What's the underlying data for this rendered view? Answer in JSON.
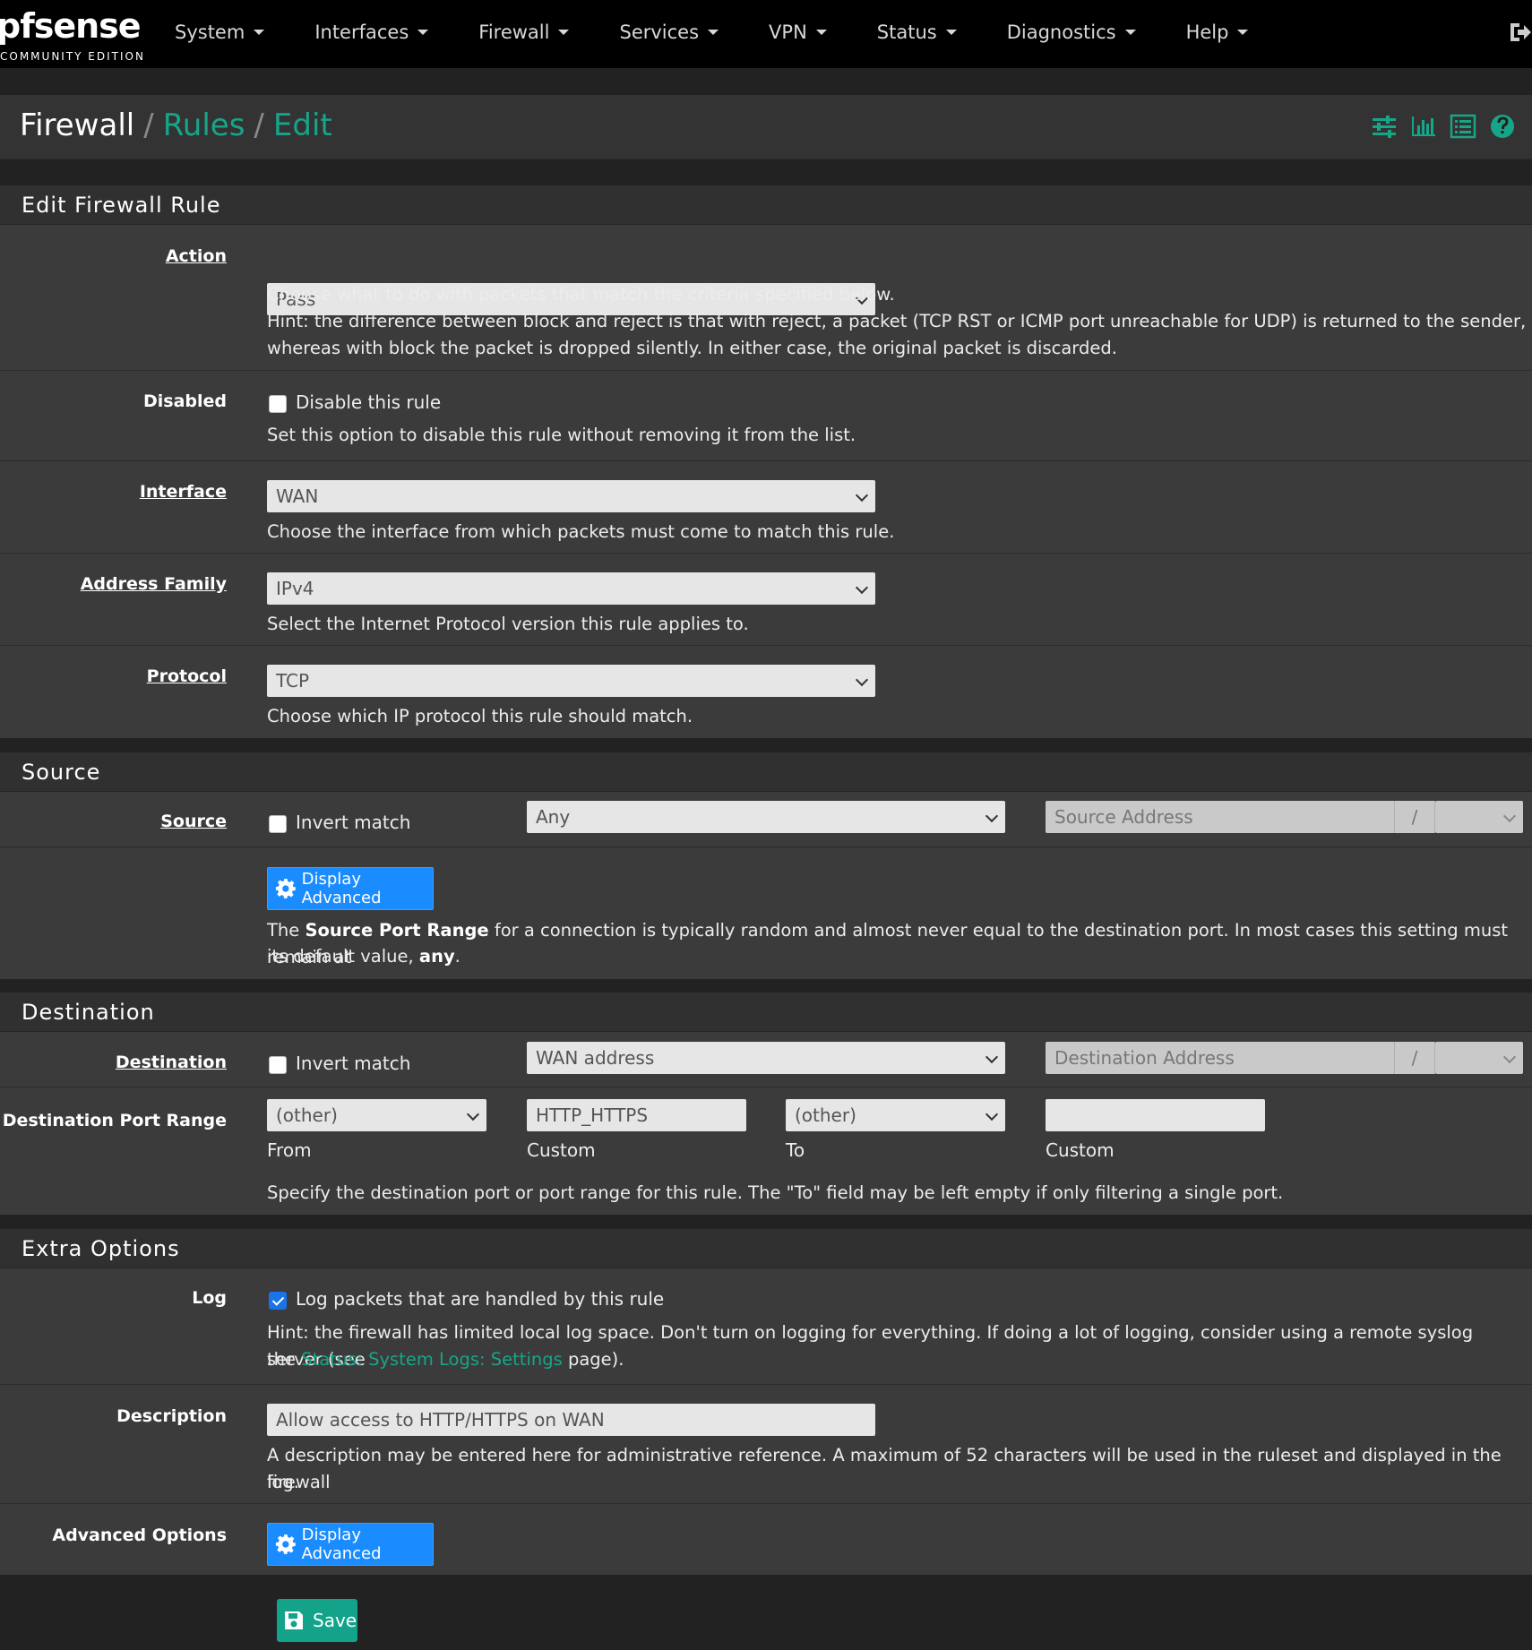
{
  "navbar": {
    "logo": "pfsense",
    "edition": "COMMUNITY EDITION",
    "items": [
      "System",
      "Interfaces",
      "Firewall",
      "Services",
      "VPN",
      "Status",
      "Diagnostics",
      "Help"
    ]
  },
  "breadcrumb": {
    "root": "Firewall",
    "sep": "/",
    "rules": "Rules",
    "edit": "Edit"
  },
  "panels": {
    "edit_rule": "Edit Firewall Rule",
    "source": "Source",
    "destination": "Destination",
    "extra": "Extra Options"
  },
  "action": {
    "label": "Action",
    "value": "Pass",
    "help1": "Choose what to do with packets that match the criteria specified below.",
    "help2": "Hint: the difference between block and reject is that with reject, a packet (TCP RST or ICMP port unreachable for UDP) is returned to the sender,",
    "help3": "whereas with block the packet is dropped silently. In either case, the original packet is discarded."
  },
  "disabled": {
    "label": "Disabled",
    "checkbox_label": "Disable this rule",
    "help": "Set this option to disable this rule without removing it from the list."
  },
  "interface": {
    "label": "Interface",
    "value": "WAN",
    "help": "Choose the interface from which packets must come to match this rule."
  },
  "address_family": {
    "label": "Address Family",
    "value": "IPv4",
    "help": "Select the Internet Protocol version this rule applies to."
  },
  "protocol": {
    "label": "Protocol",
    "value": "TCP",
    "help": "Choose which IP protocol this rule should match."
  },
  "source": {
    "label": "Source",
    "invert_label": "Invert match",
    "type_value": "Any",
    "address_placeholder": "Source Address",
    "slash": "/",
    "advanced_button": "Display Advanced",
    "help_pre": "The ",
    "help_bold": "Source Port Range",
    "help_mid": " for a connection is typically random and almost never equal to the destination port. In most cases this setting must remain at",
    "help_line2_pre": "its default value, ",
    "help_line2_bold": "any",
    "help_line2_post": "."
  },
  "destination": {
    "label": "Destination",
    "invert_label": "Invert match",
    "type_value": "WAN address",
    "address_placeholder": "Destination Address",
    "slash": "/",
    "port_range_label": "Destination Port Range",
    "from_select": "(other)",
    "from_custom": "HTTP_HTTPS",
    "to_select": "(other)",
    "to_custom": "",
    "from_label": "From",
    "custom_label": "Custom",
    "to_label": "To",
    "custom_label2": "Custom",
    "help": "Specify the destination port or port range for this rule. The \"To\" field may be left empty if only filtering a single port."
  },
  "log": {
    "label": "Log",
    "checkbox_label": "Log packets that are handled by this rule",
    "help1": "Hint: the firewall has limited local log space. Don't turn on logging for everything. If doing a lot of logging, consider using a remote syslog server (see",
    "help2_pre": "the ",
    "help2_link": "Status: System Logs: Settings",
    "help2_post": " page)."
  },
  "description": {
    "label": "Description",
    "value": "Allow access to HTTP/HTTPS on WAN",
    "help1": "A description may be entered here for administrative reference. A maximum of 52 characters will be used in the ruleset and displayed in the firewall",
    "help2": "log."
  },
  "advanced_options": {
    "label": "Advanced Options",
    "button": "Display Advanced"
  },
  "save_button": "Save",
  "colors": {
    "accent": "#17a589",
    "button_blue": "#1a8cff",
    "save_green": "#12a38a"
  }
}
